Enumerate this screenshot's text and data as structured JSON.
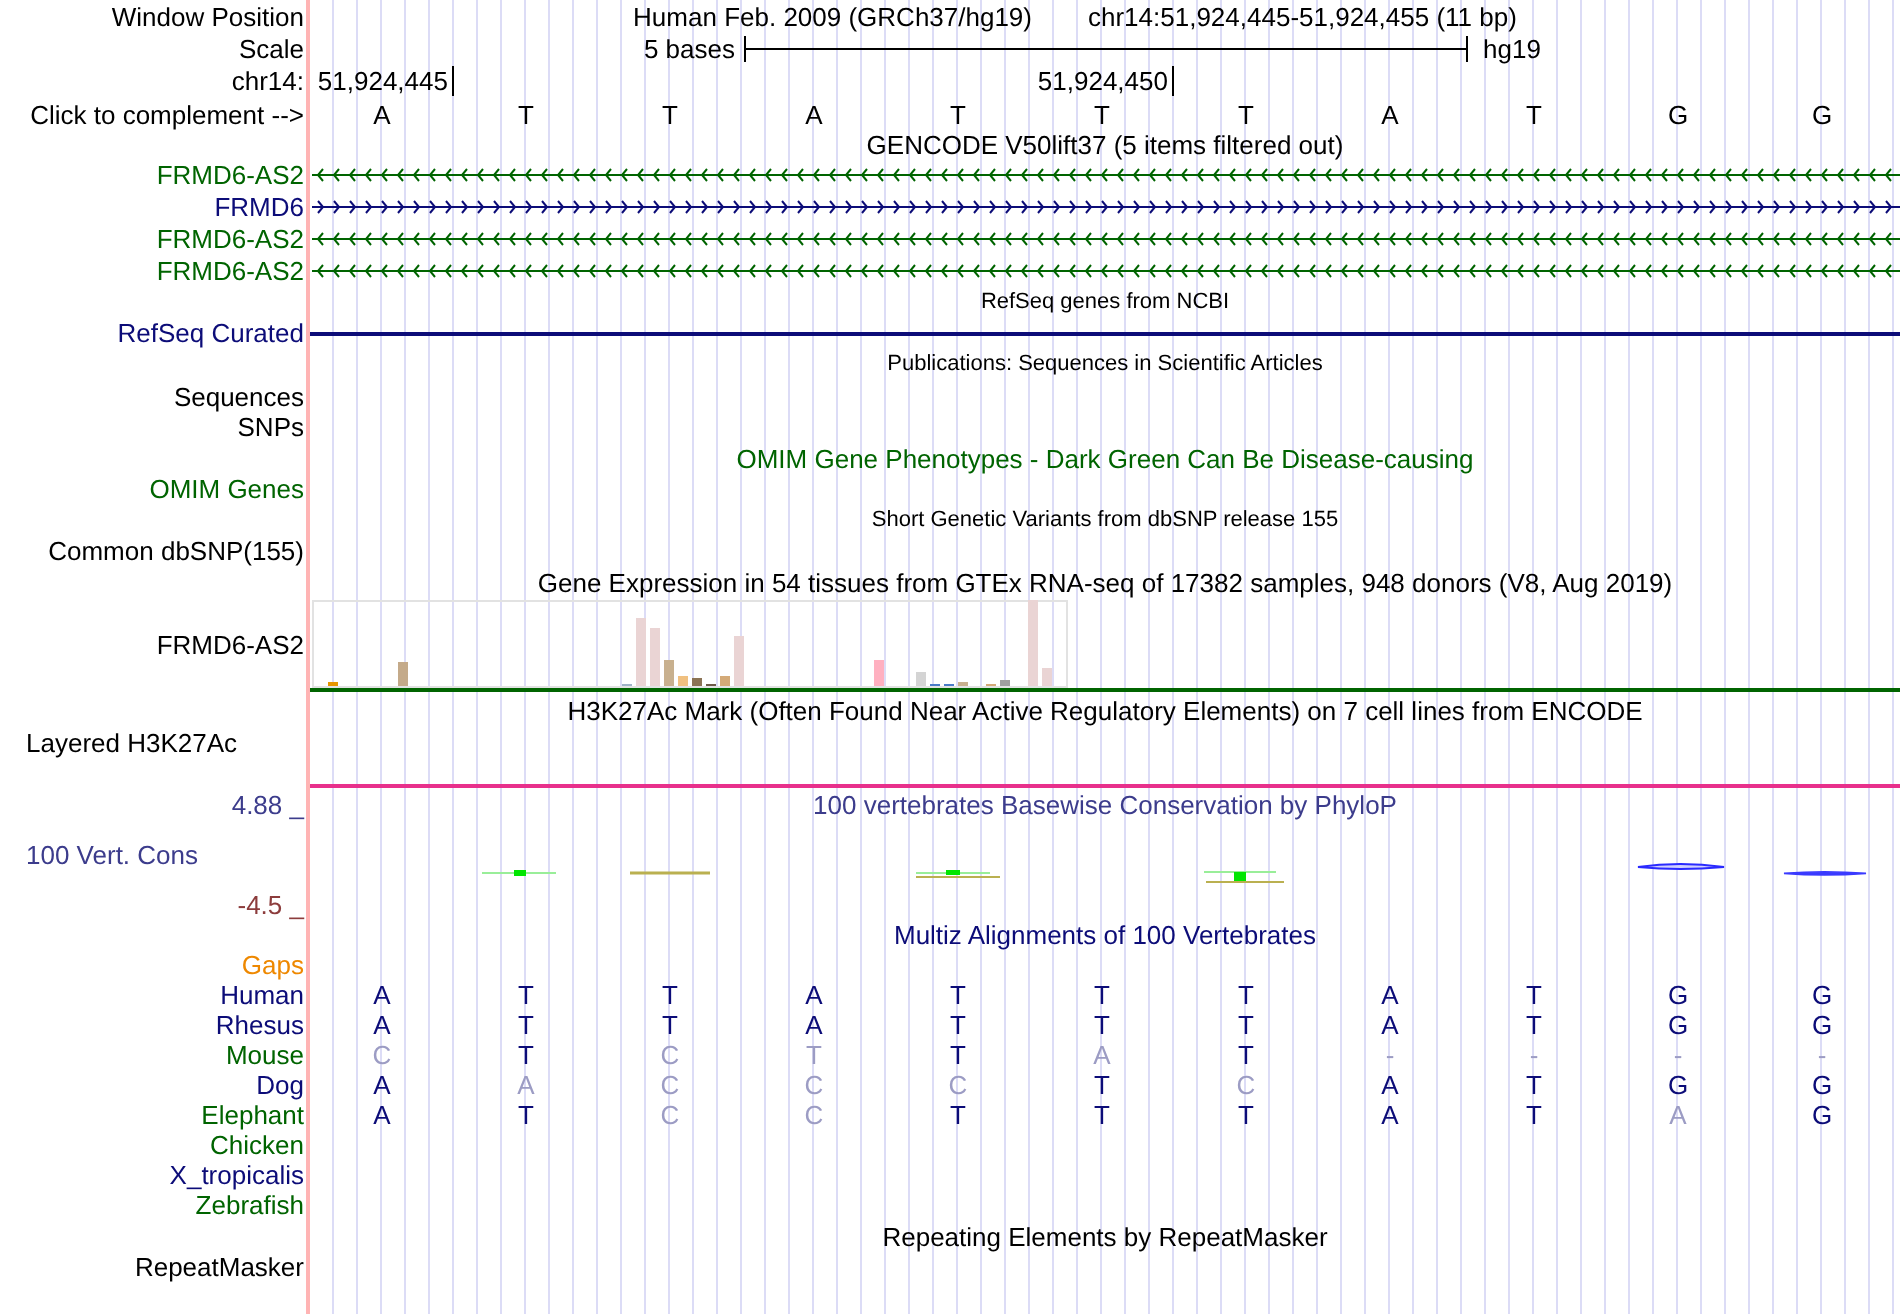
{
  "header": {
    "position_label": "Window Position",
    "assembly": "Human Feb. 2009 (GRCh37/hg19)",
    "position": "chr14:51,924,445-51,924,455 (11 bp)",
    "scale_label": "Scale",
    "scale_text": "5 bases",
    "scale_db": "hg19",
    "chrom_label": "chr14:",
    "ticks": [
      "51,924,445",
      "51,924,450"
    ],
    "complement_label": "Click to complement -->",
    "bases": [
      "A",
      "T",
      "T",
      "A",
      "T",
      "T",
      "T",
      "A",
      "T",
      "G",
      "G"
    ]
  },
  "tracks": [
    {
      "kind": "genes",
      "title": "GENCODE V50lift37 (5 items filtered out)",
      "items": [
        {
          "name": "FRMD6-AS2",
          "reverse_strand": true,
          "color": "#006400"
        },
        {
          "name": "FRMD6",
          "reverse_strand": false,
          "color": "#0c0c78"
        },
        {
          "name": "FRMD6-AS2",
          "reverse_strand": true,
          "color": "#006400"
        },
        {
          "name": "FRMD6-AS2",
          "reverse_strand": true,
          "color": "#006400"
        }
      ]
    },
    {
      "kind": "refseq",
      "title": "RefSeq genes from NCBI",
      "label": "RefSeq Curated",
      "color": "#0c0c78"
    },
    {
      "kind": "pubs",
      "title": "Publications: Sequences in Scientific Articles",
      "labels": [
        "Sequences",
        "SNPs"
      ]
    },
    {
      "kind": "omim",
      "title": "OMIM Gene Phenotypes - Dark Green Can Be Disease-causing",
      "label": "OMIM Genes",
      "color": "#006400"
    },
    {
      "kind": "snp",
      "title": "Short Genetic Variants from dbSNP release 155",
      "label": "Common dbSNP(155)"
    },
    {
      "kind": "expression",
      "title": "Gene Expression in 54 tissues from GTEx RNA-seq of 17382 samples, 948 donors (V8, Aug 2019)",
      "label": "FRMD6-AS2",
      "color": "#006400"
    },
    {
      "kind": "signal",
      "title": "H3K27Ac Mark (Often Found Near Active Regulatory Elements) on 7 cell lines from ENCODE",
      "label": "Layered H3K27Ac",
      "color": "#e8308c"
    },
    {
      "kind": "conservation",
      "title": "100 vertebrates Basewise Conservation by PhyloP",
      "label": "100 Vert. Cons",
      "color": "#3c3c8c",
      "axis_labels": [
        {
          "text": "4.88 _",
          "color": "#3c3c8c"
        },
        {
          "text": "-4.5 _",
          "color": "#8c3c3c"
        }
      ]
    },
    {
      "kind": "alignment",
      "title": "Multiz Alignments of 100 Vertebrates",
      "color": "#0c0c78",
      "rows": [
        {
          "name": "Gaps",
          "color": "#ee8800"
        },
        {
          "name": "Human",
          "color": "#0c0c78",
          "bases": [
            {
              "base": "A",
              "match": true
            },
            {
              "base": "T",
              "match": true
            },
            {
              "base": "T",
              "match": true
            },
            {
              "base": "A",
              "match": true
            },
            {
              "base": "T",
              "match": true
            },
            {
              "base": "T",
              "match": true
            },
            {
              "base": "T",
              "match": true
            },
            {
              "base": "A",
              "match": true
            },
            {
              "base": "T",
              "match": true
            },
            {
              "base": "G",
              "match": true
            },
            {
              "base": "G",
              "match": true
            }
          ]
        },
        {
          "name": "Rhesus",
          "color": "#0c0c78",
          "bases": [
            {
              "base": "A",
              "match": true
            },
            {
              "base": "T",
              "match": true
            },
            {
              "base": "T",
              "match": true
            },
            {
              "base": "A",
              "match": true
            },
            {
              "base": "T",
              "match": true
            },
            {
              "base": "T",
              "match": true
            },
            {
              "base": "T",
              "match": true
            },
            {
              "base": "A",
              "match": true
            },
            {
              "base": "T",
              "match": true
            },
            {
              "base": "G",
              "match": true
            },
            {
              "base": "G",
              "match": true
            }
          ]
        },
        {
          "name": "Mouse",
          "color": "#006400",
          "bases": [
            {
              "base": "C",
              "match": false
            },
            {
              "base": "T",
              "match": true
            },
            {
              "base": "C",
              "match": false
            },
            {
              "base": "T",
              "match": false
            },
            {
              "base": "T",
              "match": true
            },
            {
              "base": "A",
              "match": false
            },
            {
              "base": "T",
              "match": true
            },
            {
              "base": "-",
              "match": false
            },
            {
              "base": "-",
              "match": false
            },
            {
              "base": "-",
              "match": false
            },
            {
              "base": "-",
              "match": false
            }
          ]
        },
        {
          "name": "Dog",
          "color": "#0c0c78",
          "bases": [
            {
              "base": "A",
              "match": true
            },
            {
              "base": "A",
              "match": false
            },
            {
              "base": "C",
              "match": false
            },
            {
              "base": "C",
              "match": false
            },
            {
              "base": "C",
              "match": false
            },
            {
              "base": "T",
              "match": true
            },
            {
              "base": "C",
              "match": false
            },
            {
              "base": "A",
              "match": true
            },
            {
              "base": "T",
              "match": true
            },
            {
              "base": "G",
              "match": true
            },
            {
              "base": "G",
              "match": true
            }
          ]
        },
        {
          "name": "Elephant",
          "color": "#006400",
          "bases": [
            {
              "base": "A",
              "match": true
            },
            {
              "base": "T",
              "match": true
            },
            {
              "base": "C",
              "match": false
            },
            {
              "base": "C",
              "match": false
            },
            {
              "base": "T",
              "match": true
            },
            {
              "base": "T",
              "match": true
            },
            {
              "base": "T",
              "match": true
            },
            {
              "base": "A",
              "match": true
            },
            {
              "base": "T",
              "match": true
            },
            {
              "base": "A",
              "match": false
            },
            {
              "base": "G",
              "match": true
            }
          ]
        },
        {
          "name": "Chicken",
          "color": "#006400"
        },
        {
          "name": "X_tropicalis",
          "color": "#0c0c78"
        },
        {
          "name": "Zebrafish",
          "color": "#006400"
        }
      ]
    },
    {
      "kind": "repeats",
      "title": "Repeating Elements by RepeatMasker",
      "label": "RepeatMasker"
    }
  ]
}
